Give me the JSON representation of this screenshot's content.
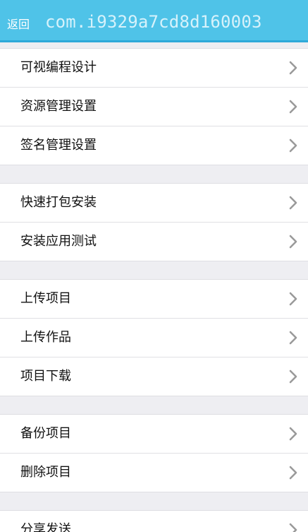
{
  "header": {
    "back_label": "返回",
    "title": "com.i9329a7cd8d160003"
  },
  "groups": [
    {
      "items": [
        {
          "label": "可视编程设计"
        },
        {
          "label": "资源管理设置"
        },
        {
          "label": "签名管理设置"
        }
      ]
    },
    {
      "items": [
        {
          "label": "快速打包安装"
        },
        {
          "label": "安装应用测试"
        }
      ]
    },
    {
      "items": [
        {
          "label": "上传项目"
        },
        {
          "label": "上传作品"
        },
        {
          "label": "项目下载"
        }
      ]
    },
    {
      "items": [
        {
          "label": "备份项目"
        },
        {
          "label": "删除项目"
        }
      ]
    },
    {
      "items": [
        {
          "label": "分享发送"
        }
      ]
    }
  ],
  "icons": {
    "row_arrow": "chevron-right-icon"
  },
  "colors": {
    "header_bg": "#4fc3e8",
    "header_border": "#2fa9d9",
    "page_bg": "#eeeef2",
    "row_bg": "#ffffff",
    "chevron": "#9a9a9a"
  }
}
